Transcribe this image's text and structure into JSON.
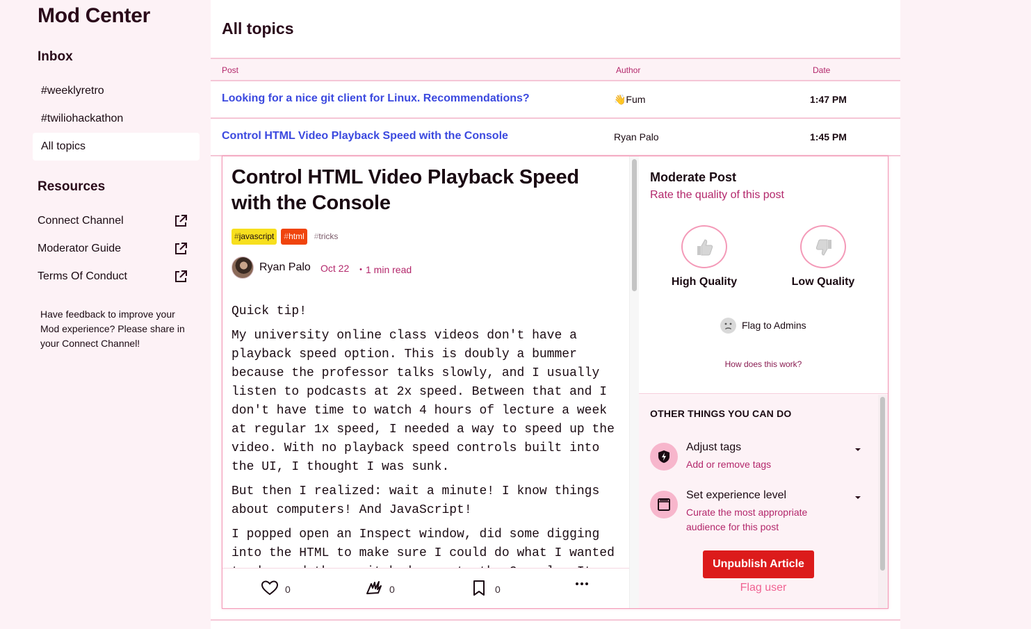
{
  "sidebar": {
    "brand": "Mod Center",
    "inbox_title": "Inbox",
    "inbox_items": [
      {
        "label": "#weeklyretro"
      },
      {
        "label": "#twiliohackathon"
      },
      {
        "label": "All topics"
      }
    ],
    "resources_title": "Resources",
    "resources": [
      {
        "label": "Connect Channel"
      },
      {
        "label": "Moderator Guide"
      },
      {
        "label": "Terms Of Conduct"
      }
    ],
    "feedback": "Have feedback to improve your Mod experience? Please share in your Connect Channel!"
  },
  "main": {
    "title": "All topics",
    "columns": {
      "post": "Post",
      "author": "Author",
      "date": "Date"
    },
    "rows": [
      {
        "title": "Looking for a nice git client for Linux. Recommendations?",
        "author": "👋Fum",
        "date": "1:47 PM"
      },
      {
        "title": "Control HTML Video Playback Speed with the Console",
        "author": "Ryan Palo",
        "date": "1:45 PM"
      }
    ]
  },
  "article": {
    "title": "Control HTML Video Playback Speed with the Console",
    "tags": [
      {
        "hash": "#",
        "name": "javascript"
      },
      {
        "hash": "#",
        "name": "html"
      },
      {
        "hash": "#",
        "name": "tricks"
      }
    ],
    "author": "Ryan Palo",
    "date": "Oct 22",
    "read_time": "・1 min read",
    "paragraphs": [
      "Quick tip!",
      "My university online class videos don't have a playback speed option. This is doubly a bummer because the professor talks slowly, and I usually listen to podcasts at 2x speed. Between that and I don't have time to watch 4 hours of lecture a week at regular 1x speed, I needed a way to speed up the video. With no playback speed controls built into the UI, I thought I was sunk.",
      "But then I realized: wait a minute! I know things about computers! And JavaScript!",
      "I popped open an Inspect window, did some digging into the HTML to make sure I could do what I wanted to do, and then switched over to the Console. It"
    ],
    "reactions": {
      "hearts": "0",
      "unicorns": "0",
      "bookmarks": "0"
    }
  },
  "moderate": {
    "title": "Moderate Post",
    "subtitle": "Rate the quality of this post",
    "high_quality": "High Quality",
    "low_quality": "Low Quality",
    "flag_admins": "Flag to Admins",
    "how_link": "How does this work?",
    "other_title": "OTHER THINGS YOU CAN DO",
    "options": [
      {
        "title": "Adjust tags",
        "desc": "Add or remove tags",
        "icon": "shield-bolt-icon"
      },
      {
        "title": "Set experience level",
        "desc": "Curate the most appropriate audience for this post",
        "icon": "window-icon"
      }
    ],
    "unpublish": "Unpublish Article",
    "flag_user": "Flag user"
  },
  "colors": {
    "accent": "#b3276b",
    "link": "#3b49df",
    "danger": "#dc1b1b",
    "border": "#f5c6d6",
    "sidebar_bg": "#fdf2f6"
  }
}
